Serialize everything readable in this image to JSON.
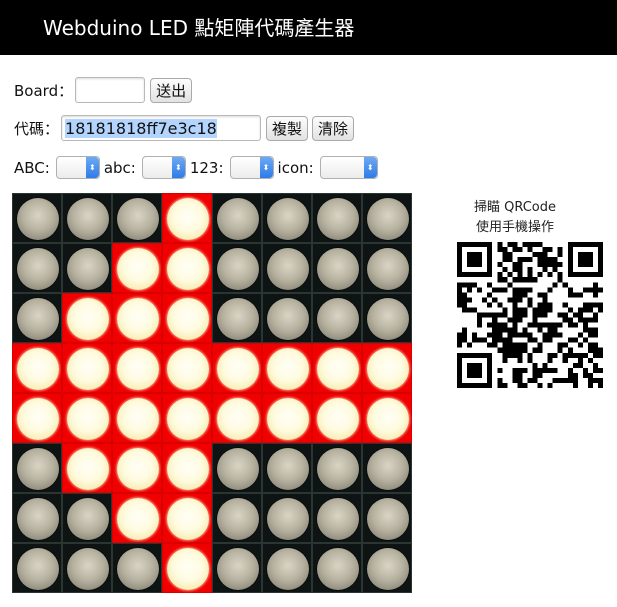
{
  "header": {
    "title": "Webduino LED 點矩陣代碼產生器"
  },
  "controls": {
    "board_label": "Board：",
    "board_value": "",
    "send_button": "送出",
    "code_label": "代碼：",
    "code_value": "18181818ff7e3c18",
    "copy_button": "複製",
    "clear_button": "清除",
    "selects": [
      {
        "label": "ABC:",
        "value": ""
      },
      {
        "label": "abc:",
        "value": ""
      },
      {
        "label": "123:",
        "value": ""
      },
      {
        "label": "icon:",
        "value": ""
      }
    ]
  },
  "matrix": {
    "rows": 8,
    "cols": 8,
    "on_color": "#f00000",
    "hex_rows": [
      "08",
      "0c",
      "0e",
      "ff",
      "ff",
      "0e",
      "0c",
      "08"
    ]
  },
  "qr": {
    "caption_line1": "掃瞄 QRCode",
    "caption_line2": "使用手機操作"
  }
}
